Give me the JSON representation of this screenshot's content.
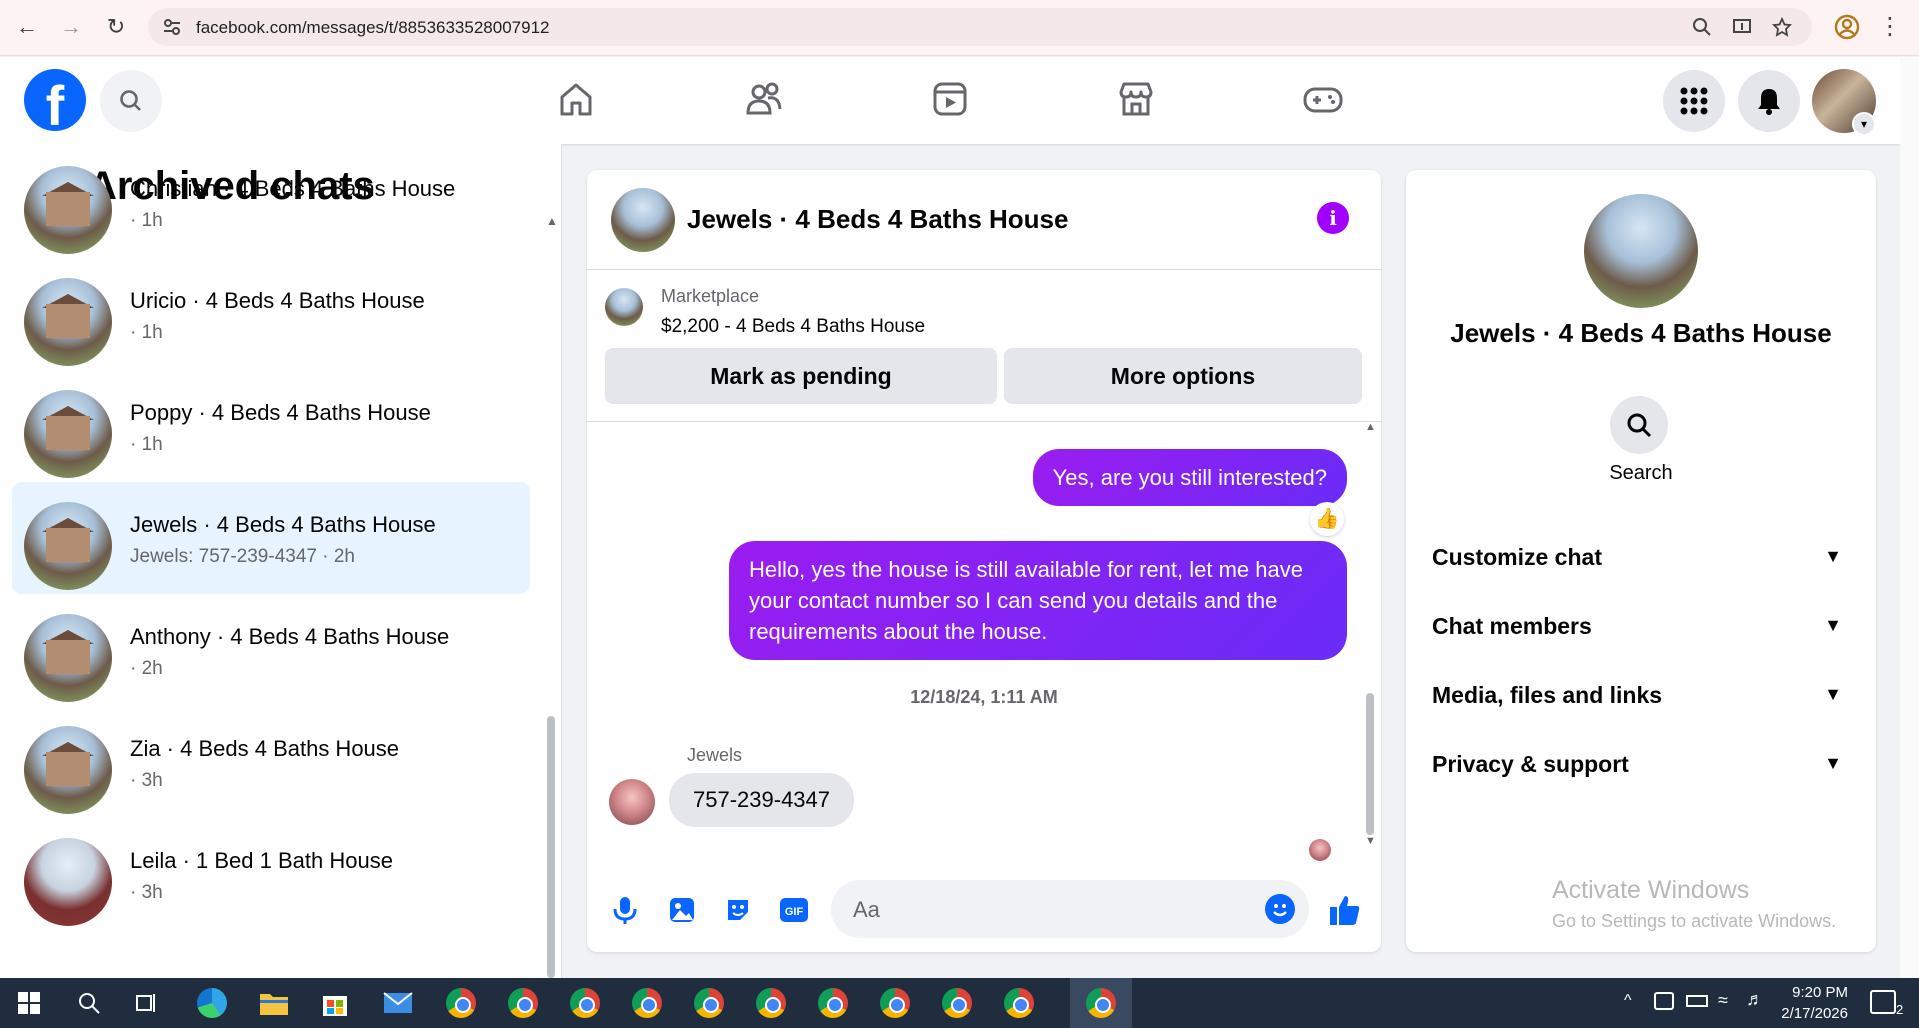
{
  "browser": {
    "url": "facebook.com/messages/t/8853633528007912"
  },
  "nav": {
    "tabs": [
      "home",
      "friends",
      "video",
      "marketplace",
      "gaming"
    ]
  },
  "archived": {
    "title": "Archived chats",
    "chats": [
      {
        "name": "Christian · 4 Beds 4 Baths House",
        "sub": "· 1h"
      },
      {
        "name": "Uricio · 4 Beds 4 Baths House",
        "sub": "· 1h"
      },
      {
        "name": "Poppy · 4 Beds 4 Baths House",
        "sub": "· 1h"
      },
      {
        "name": "Jewels · 4 Beds 4 Baths House",
        "sub": "Jewels: 757-239-4347 · 2h",
        "active": true
      },
      {
        "name": "Anthony · 4 Beds 4 Baths House",
        "sub": "· 2h"
      },
      {
        "name": "Zia · 4 Beds 4 Baths House",
        "sub": "· 3h"
      },
      {
        "name": "Leila · 1 Bed 1 Bath House",
        "sub": "· 3h"
      }
    ]
  },
  "conversation": {
    "title": "Jewels · 4 Beds 4 Baths House",
    "marketplace_label": "Marketplace",
    "listing": "$2,200 - 4 Beds 4 Baths House",
    "mark_pending": "Mark as pending",
    "more_options": "More options",
    "msg_out_1": "Yes, are you still interested?",
    "msg_out_1_reaction": "👍",
    "msg_out_2": "Hello, yes the house is still available for rent, let me have your contact number so I can send you details and the requirements about the house.",
    "timestamp": "12/18/24, 1:11 AM",
    "sender": "Jewels",
    "msg_in": "757-239-4347",
    "composer_placeholder": "Aa"
  },
  "details": {
    "title": "Jewels · 4 Beds 4 Baths House",
    "search_label": "Search",
    "sections": [
      "Customize chat",
      "Chat members",
      "Media, files and links",
      "Privacy & support"
    ]
  },
  "watermark": {
    "line1": "Activate Windows",
    "line2": "Go to Settings to activate Windows."
  },
  "taskbar": {
    "time": "9:20 PM",
    "date": "2/17/2026",
    "notification_count": "2"
  },
  "colors": {
    "fb_blue": "#0866ff",
    "bubble_purple": "#8a23f2",
    "active_row": "#e7f3ff"
  }
}
